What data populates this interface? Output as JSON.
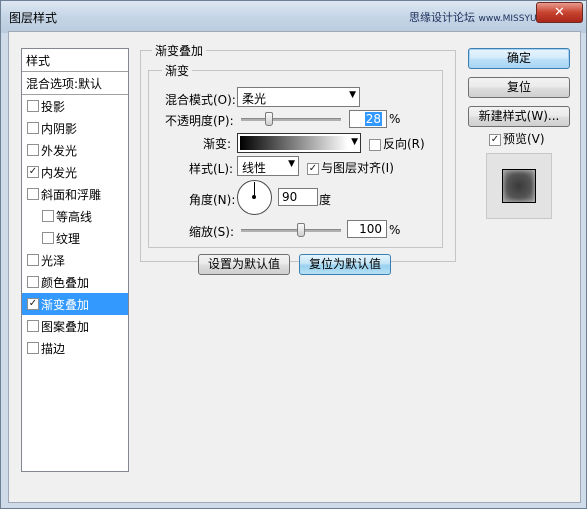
{
  "window": {
    "title": "图层样式",
    "watermark": "思缘设计论坛",
    "watermark_url": "www.MISSYUAN.COM",
    "close_glyph": "✕"
  },
  "styles_list": {
    "header": "样式",
    "blend_options": "混合选项:默认",
    "items": [
      {
        "label": "投影",
        "checked": false,
        "selected": false,
        "sub": false
      },
      {
        "label": "内阴影",
        "checked": false,
        "selected": false,
        "sub": false
      },
      {
        "label": "外发光",
        "checked": false,
        "selected": false,
        "sub": false
      },
      {
        "label": "内发光",
        "checked": true,
        "selected": false,
        "sub": false
      },
      {
        "label": "斜面和浮雕",
        "checked": false,
        "selected": false,
        "sub": false
      },
      {
        "label": "等高线",
        "checked": false,
        "selected": false,
        "sub": true
      },
      {
        "label": "纹理",
        "checked": false,
        "selected": false,
        "sub": true
      },
      {
        "label": "光泽",
        "checked": false,
        "selected": false,
        "sub": false
      },
      {
        "label": "颜色叠加",
        "checked": false,
        "selected": false,
        "sub": false
      },
      {
        "label": "渐变叠加",
        "checked": true,
        "selected": true,
        "sub": false
      },
      {
        "label": "图案叠加",
        "checked": false,
        "selected": false,
        "sub": false
      },
      {
        "label": "描边",
        "checked": false,
        "selected": false,
        "sub": false
      }
    ]
  },
  "gradient_overlay": {
    "group_title": "渐变叠加",
    "subgroup_title": "渐变",
    "blend_mode_label": "混合模式(O):",
    "blend_mode_value": "柔光",
    "opacity_label": "不透明度(P):",
    "opacity_value": "28",
    "opacity_level": 0.28,
    "percent": "%",
    "gradient_label": "渐变:",
    "reverse_label": "反向(R)",
    "reverse_checked": false,
    "style_label": "样式(L):",
    "style_value": "线性",
    "align_label": "与图层对齐(I)",
    "align_checked": true,
    "angle_label": "角度(N):",
    "angle_value": "90",
    "degree_unit": "度",
    "scale_label": "缩放(S):",
    "scale_value": "100",
    "scale_level": 1.0,
    "make_default": "设置为默认值",
    "reset_default": "复位为默认值"
  },
  "right_panel": {
    "ok": "确定",
    "reset": "复位",
    "new_style": "新建样式(W)...",
    "preview_label": "预览(V)",
    "preview_checked": true
  },
  "icons": {
    "check": "✓",
    "dropdown": "▼"
  },
  "colors": {
    "selection": "#3399ff",
    "close_button": "#c8432f"
  }
}
